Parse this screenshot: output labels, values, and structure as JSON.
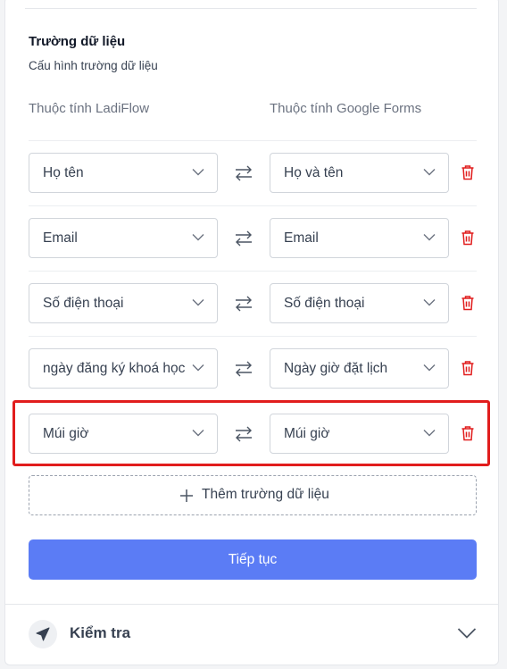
{
  "section": {
    "title": "Trường dữ liệu",
    "subtitle": "Cấu hình trường dữ liệu"
  },
  "columns": {
    "left": "Thuộc tính LadiFlow",
    "right": "Thuộc tính Google Forms"
  },
  "rows": [
    {
      "left": "Họ tên",
      "right": "Họ và tên"
    },
    {
      "left": "Email",
      "right": "Email"
    },
    {
      "left": "Số điện thoại",
      "right": "Số điện thoại"
    },
    {
      "left": "ngày đăng ký khoá học",
      "right": "Ngày giờ đặt lịch"
    },
    {
      "left": "Múi giờ",
      "right": "Múi giờ"
    }
  ],
  "add_field_label": "Thêm trường dữ liệu",
  "continue_label": "Tiếp tục",
  "check_section": {
    "label": "Kiểm tra",
    "icon": "paper-plane-icon"
  },
  "colors": {
    "primary": "#5b7cf5",
    "danger": "#e11d1d",
    "highlight": "#e11d1d"
  }
}
